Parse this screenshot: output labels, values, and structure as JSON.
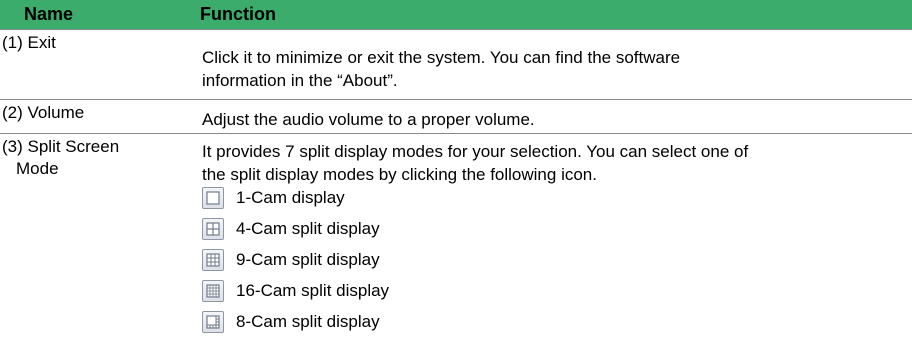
{
  "header": {
    "name": "Name",
    "function": "Function"
  },
  "rows": [
    {
      "name": "(1) Exit",
      "func_lines": [
        "Click it to minimize or exit the system. You can find the software",
        "information in the “About”."
      ]
    },
    {
      "name": "(2) Volume",
      "func_lines": [
        "Adjust the audio volume to a proper volume."
      ]
    },
    {
      "name_line1": "(3) Split Screen",
      "name_line2": "Mode",
      "func_lines": [
        "It provides 7 split display modes for your selection. You can select one of",
        "the split display modes by clicking the following icon."
      ],
      "modes": [
        {
          "label": "1-Cam display",
          "icon": "single-screen-icon"
        },
        {
          "label": "4-Cam split display",
          "icon": "quad-split-icon"
        },
        {
          "label": "9-Cam split display",
          "icon": "nine-split-icon"
        },
        {
          "label": "16-Cam split display",
          "icon": "sixteen-split-icon"
        },
        {
          "label": "8-Cam split display",
          "icon": "eight-split-icon"
        }
      ]
    }
  ],
  "colors": {
    "header_bg": "#3cac6c",
    "border": "#8a8a8a",
    "icon_stroke": "#6f7c8c"
  }
}
